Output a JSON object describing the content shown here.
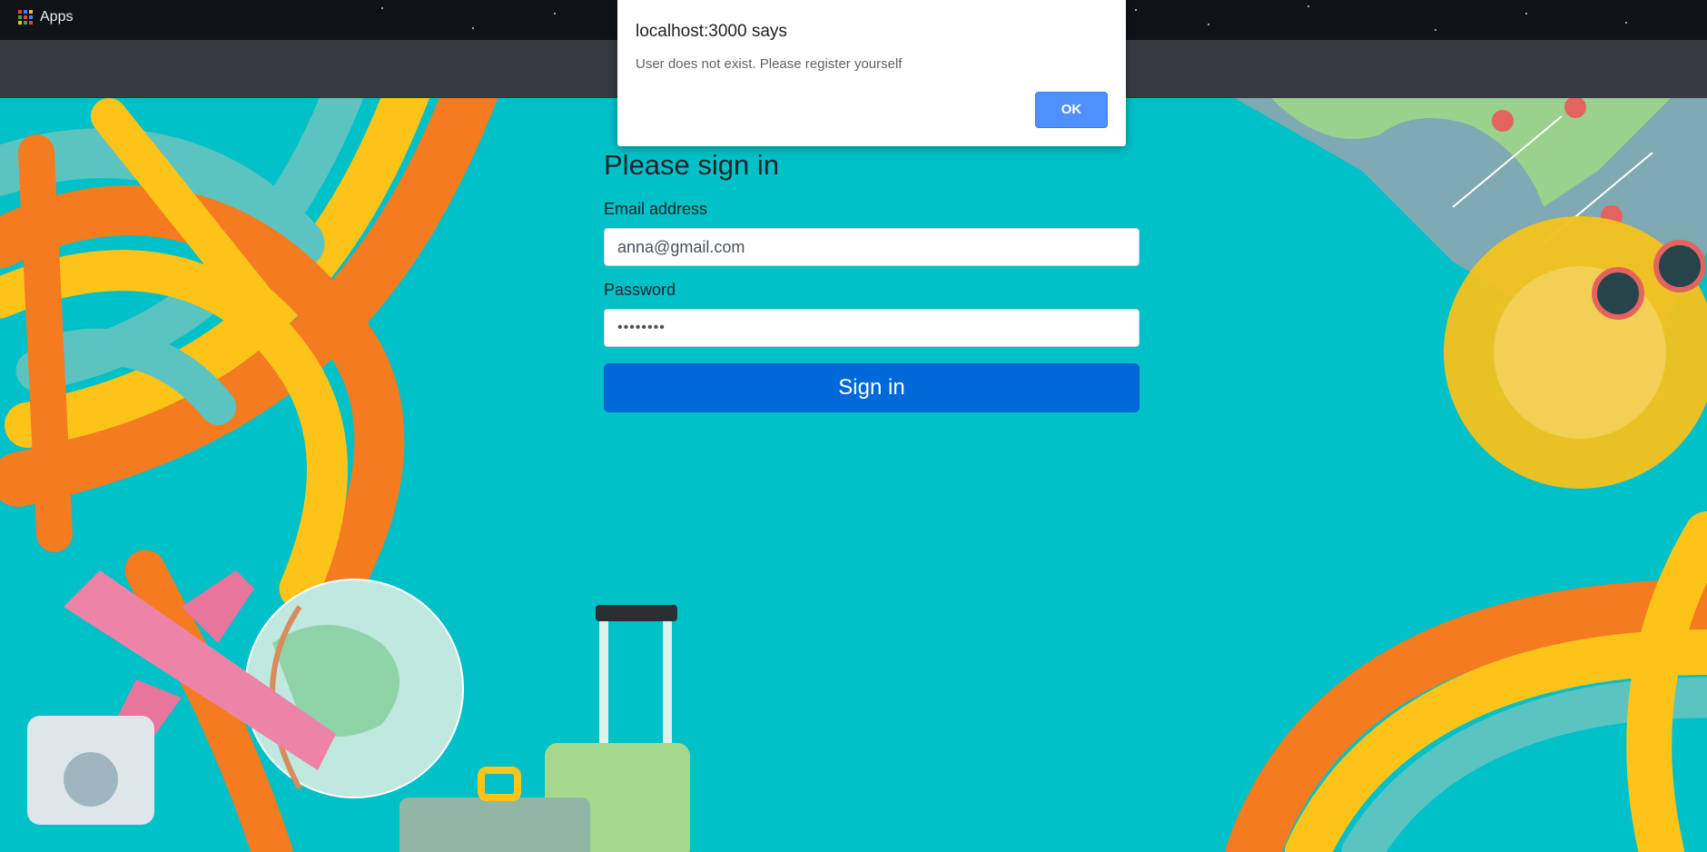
{
  "bookmarks": {
    "apps_label": "Apps"
  },
  "dialog": {
    "title": "localhost:3000 says",
    "message": "User does not exist. Please register yourself",
    "ok_label": "OK"
  },
  "signin": {
    "heading": "Please sign in",
    "email_label": "Email address",
    "email_value": "anna@gmail.com",
    "password_label": "Password",
    "password_masked": "••••••••",
    "submit_label": "Sign in"
  },
  "colors": {
    "background": "#00c0c8",
    "navbar": "#343a40",
    "primary_button": "#0069d9",
    "dialog_ok": "#4d90fe",
    "stripe_orange": "#f47b20",
    "stripe_yellow": "#fcc419",
    "stripe_teal": "#5bc4c0"
  }
}
